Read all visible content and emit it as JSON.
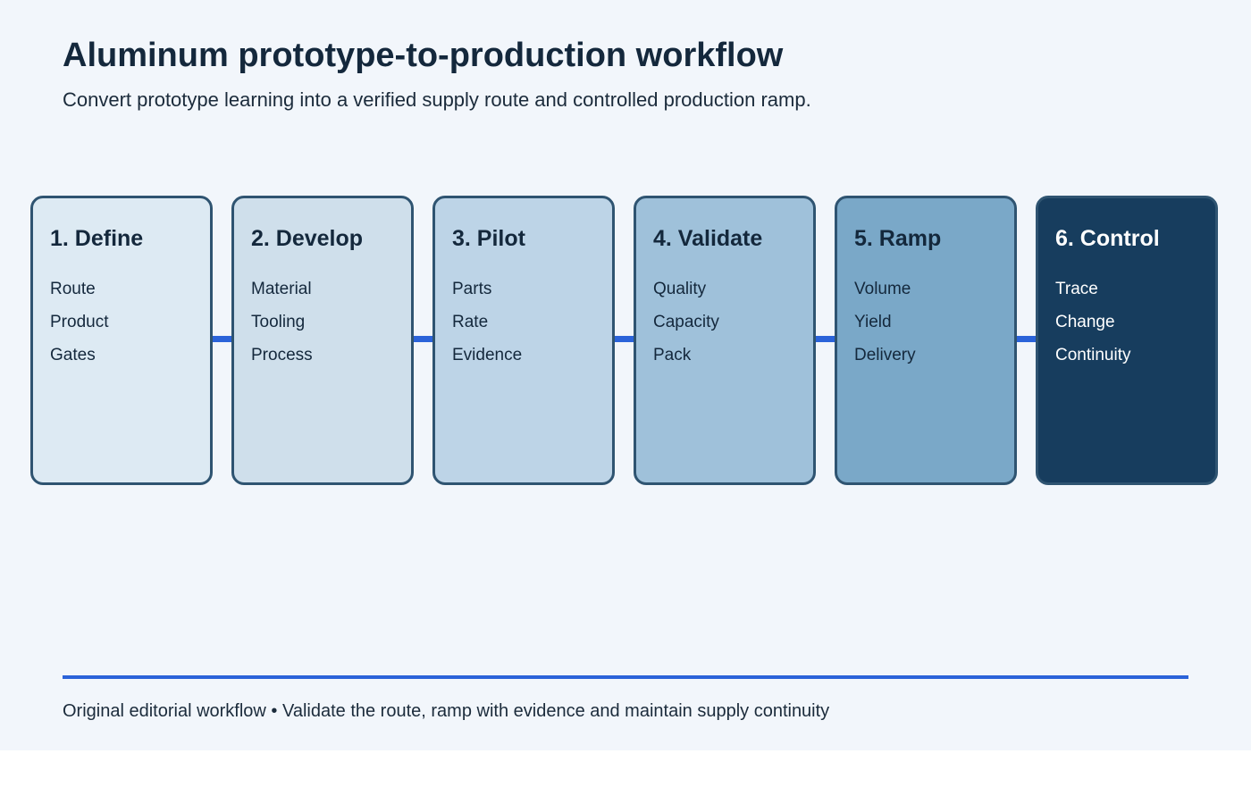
{
  "header": {
    "title": "Aluminum prototype-to-production workflow",
    "subtitle": "Convert prototype learning into a verified supply route and controlled production ramp."
  },
  "colors": {
    "background": "#f2f6fb",
    "connector": "#2b63d9",
    "border": "#2f5471",
    "dark_text": "#14283c",
    "light_text": "#ffffff"
  },
  "stages": [
    {
      "title": "1. Define",
      "items": [
        "Route",
        "Product",
        "Gates"
      ],
      "fill": "#ddeaf3",
      "text_color": "#14283c"
    },
    {
      "title": "2. Develop",
      "items": [
        "Material",
        "Tooling",
        "Process"
      ],
      "fill": "#cfdfeb",
      "text_color": "#14283c"
    },
    {
      "title": "3. Pilot",
      "items": [
        "Parts",
        "Rate",
        "Evidence"
      ],
      "fill": "#bdd4e7",
      "text_color": "#14283c"
    },
    {
      "title": "4. Validate",
      "items": [
        "Quality",
        "Capacity",
        "Pack"
      ],
      "fill": "#9fc1da",
      "text_color": "#14283c"
    },
    {
      "title": "5. Ramp",
      "items": [
        "Volume",
        "Yield",
        "Delivery"
      ],
      "fill": "#7aa8c8",
      "text_color": "#14283c"
    },
    {
      "title": "6. Control",
      "items": [
        "Trace",
        "Change",
        "Continuity"
      ],
      "fill": "#173d5e",
      "text_color": "#ffffff"
    }
  ],
  "footer": {
    "text": "Original editorial workflow • Validate the route, ramp with evidence and maintain supply continuity"
  }
}
